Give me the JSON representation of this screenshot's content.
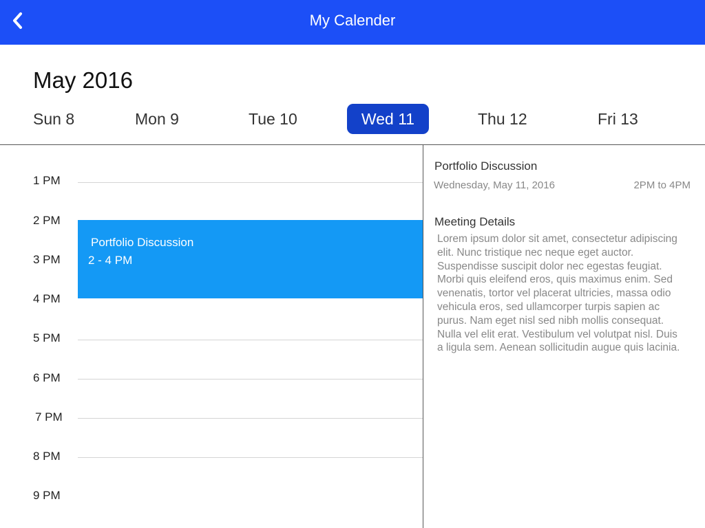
{
  "header": {
    "title": "My Calender",
    "back_icon": "chevron-left-icon",
    "background": "#1c4ff7"
  },
  "calendar": {
    "month_label": "May 2016",
    "days": [
      {
        "label": "Sun 8",
        "selected": false
      },
      {
        "label": "Mon 9",
        "selected": false
      },
      {
        "label": "Tue 10",
        "selected": false
      },
      {
        "label": "Wed 11",
        "selected": true
      },
      {
        "label": "Thu 12",
        "selected": false
      },
      {
        "label": "Fri 13",
        "selected": false
      }
    ],
    "selected_color": "#1341c9"
  },
  "timeline": {
    "hours": [
      "1 PM",
      "2 PM",
      "3 PM",
      "4 PM",
      "5 PM",
      "6 PM",
      "7 PM",
      "8 PM",
      "9 PM"
    ],
    "event": {
      "title": "Portfolio Discussion",
      "time": "2 - 4 PM",
      "color": "#1499f5"
    }
  },
  "details": {
    "title": "Portfolio Discussion",
    "date": "Wednesday, May 11, 2016",
    "hours": "2PM to 4PM",
    "section_heading": "Meeting Details",
    "body_lines": [
      "Lorem ipsum dolor sit amet, consectetur adipiscing",
      "elit. Nunc tristique nec neque eget auctor.",
      "Suspendisse suscipit dolor nec egestas feugiat.",
      "Morbi quis eleifend eros, quis maximus enim. Sed",
      "venenatis, tortor vel placerat ultricies, massa odio",
      "vehicula eros, sed ullamcorper turpis sapien ac",
      "purus. Nam eget nisl sed nibh mollis consequat.",
      "Nulla vel elit erat. Vestibulum vel volutpat nisl. Duis",
      "a ligula sem. Aenean sollicitudin augue quis lacinia."
    ]
  }
}
